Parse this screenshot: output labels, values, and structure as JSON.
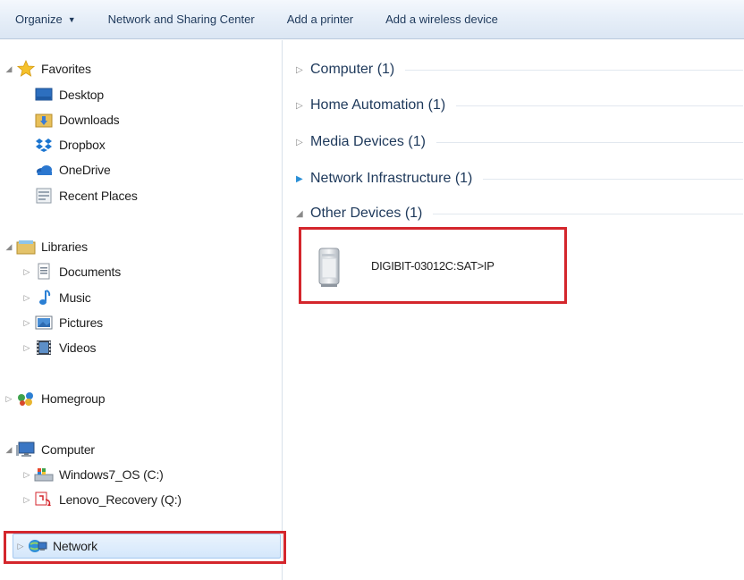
{
  "toolbar": {
    "organize": "Organize",
    "network_sharing": "Network and Sharing Center",
    "add_printer": "Add a printer",
    "add_wireless": "Add a wireless device"
  },
  "sidebar": {
    "favorites": {
      "label": "Favorites",
      "icon": "star-icon"
    },
    "desktop": {
      "label": "Desktop",
      "icon": "desktop-icon"
    },
    "downloads": {
      "label": "Downloads",
      "icon": "downloads-folder-icon"
    },
    "dropbox": {
      "label": "Dropbox",
      "icon": "dropbox-icon"
    },
    "onedrive": {
      "label": "OneDrive",
      "icon": "onedrive-icon"
    },
    "recent": {
      "label": "Recent Places",
      "icon": "recent-places-icon"
    },
    "libraries": {
      "label": "Libraries",
      "icon": "libraries-icon"
    },
    "documents": {
      "label": "Documents",
      "icon": "documents-icon"
    },
    "music": {
      "label": "Music",
      "icon": "music-icon"
    },
    "pictures": {
      "label": "Pictures",
      "icon": "pictures-icon"
    },
    "videos": {
      "label": "Videos",
      "icon": "videos-icon"
    },
    "homegroup": {
      "label": "Homegroup",
      "icon": "homegroup-icon"
    },
    "computer": {
      "label": "Computer",
      "icon": "computer-icon"
    },
    "windows_os": {
      "label": "Windows7_OS (C:)",
      "icon": "drive-icon"
    },
    "lenovo_recovery": {
      "label": "Lenovo_Recovery (Q:)",
      "icon": "recovery-drive-icon"
    },
    "network": {
      "label": "Network",
      "icon": "network-icon"
    }
  },
  "main": {
    "groups": [
      {
        "title": "Computer (1)",
        "expanded": false
      },
      {
        "title": "Home Automation (1)",
        "expanded": false
      },
      {
        "title": "Media Devices (1)",
        "expanded": false
      },
      {
        "title": "Network Infrastructure (1)",
        "expanded": false
      },
      {
        "title": "Other Devices (1)",
        "expanded": true
      }
    ],
    "device": {
      "name": "DIGIBIT-03012C:SAT>IP",
      "icon": "media-server-icon"
    }
  },
  "colors": {
    "highlight_red": "#d4262c",
    "toolbar_text": "#1e395b",
    "selection_blue": "#d4e7fb"
  }
}
